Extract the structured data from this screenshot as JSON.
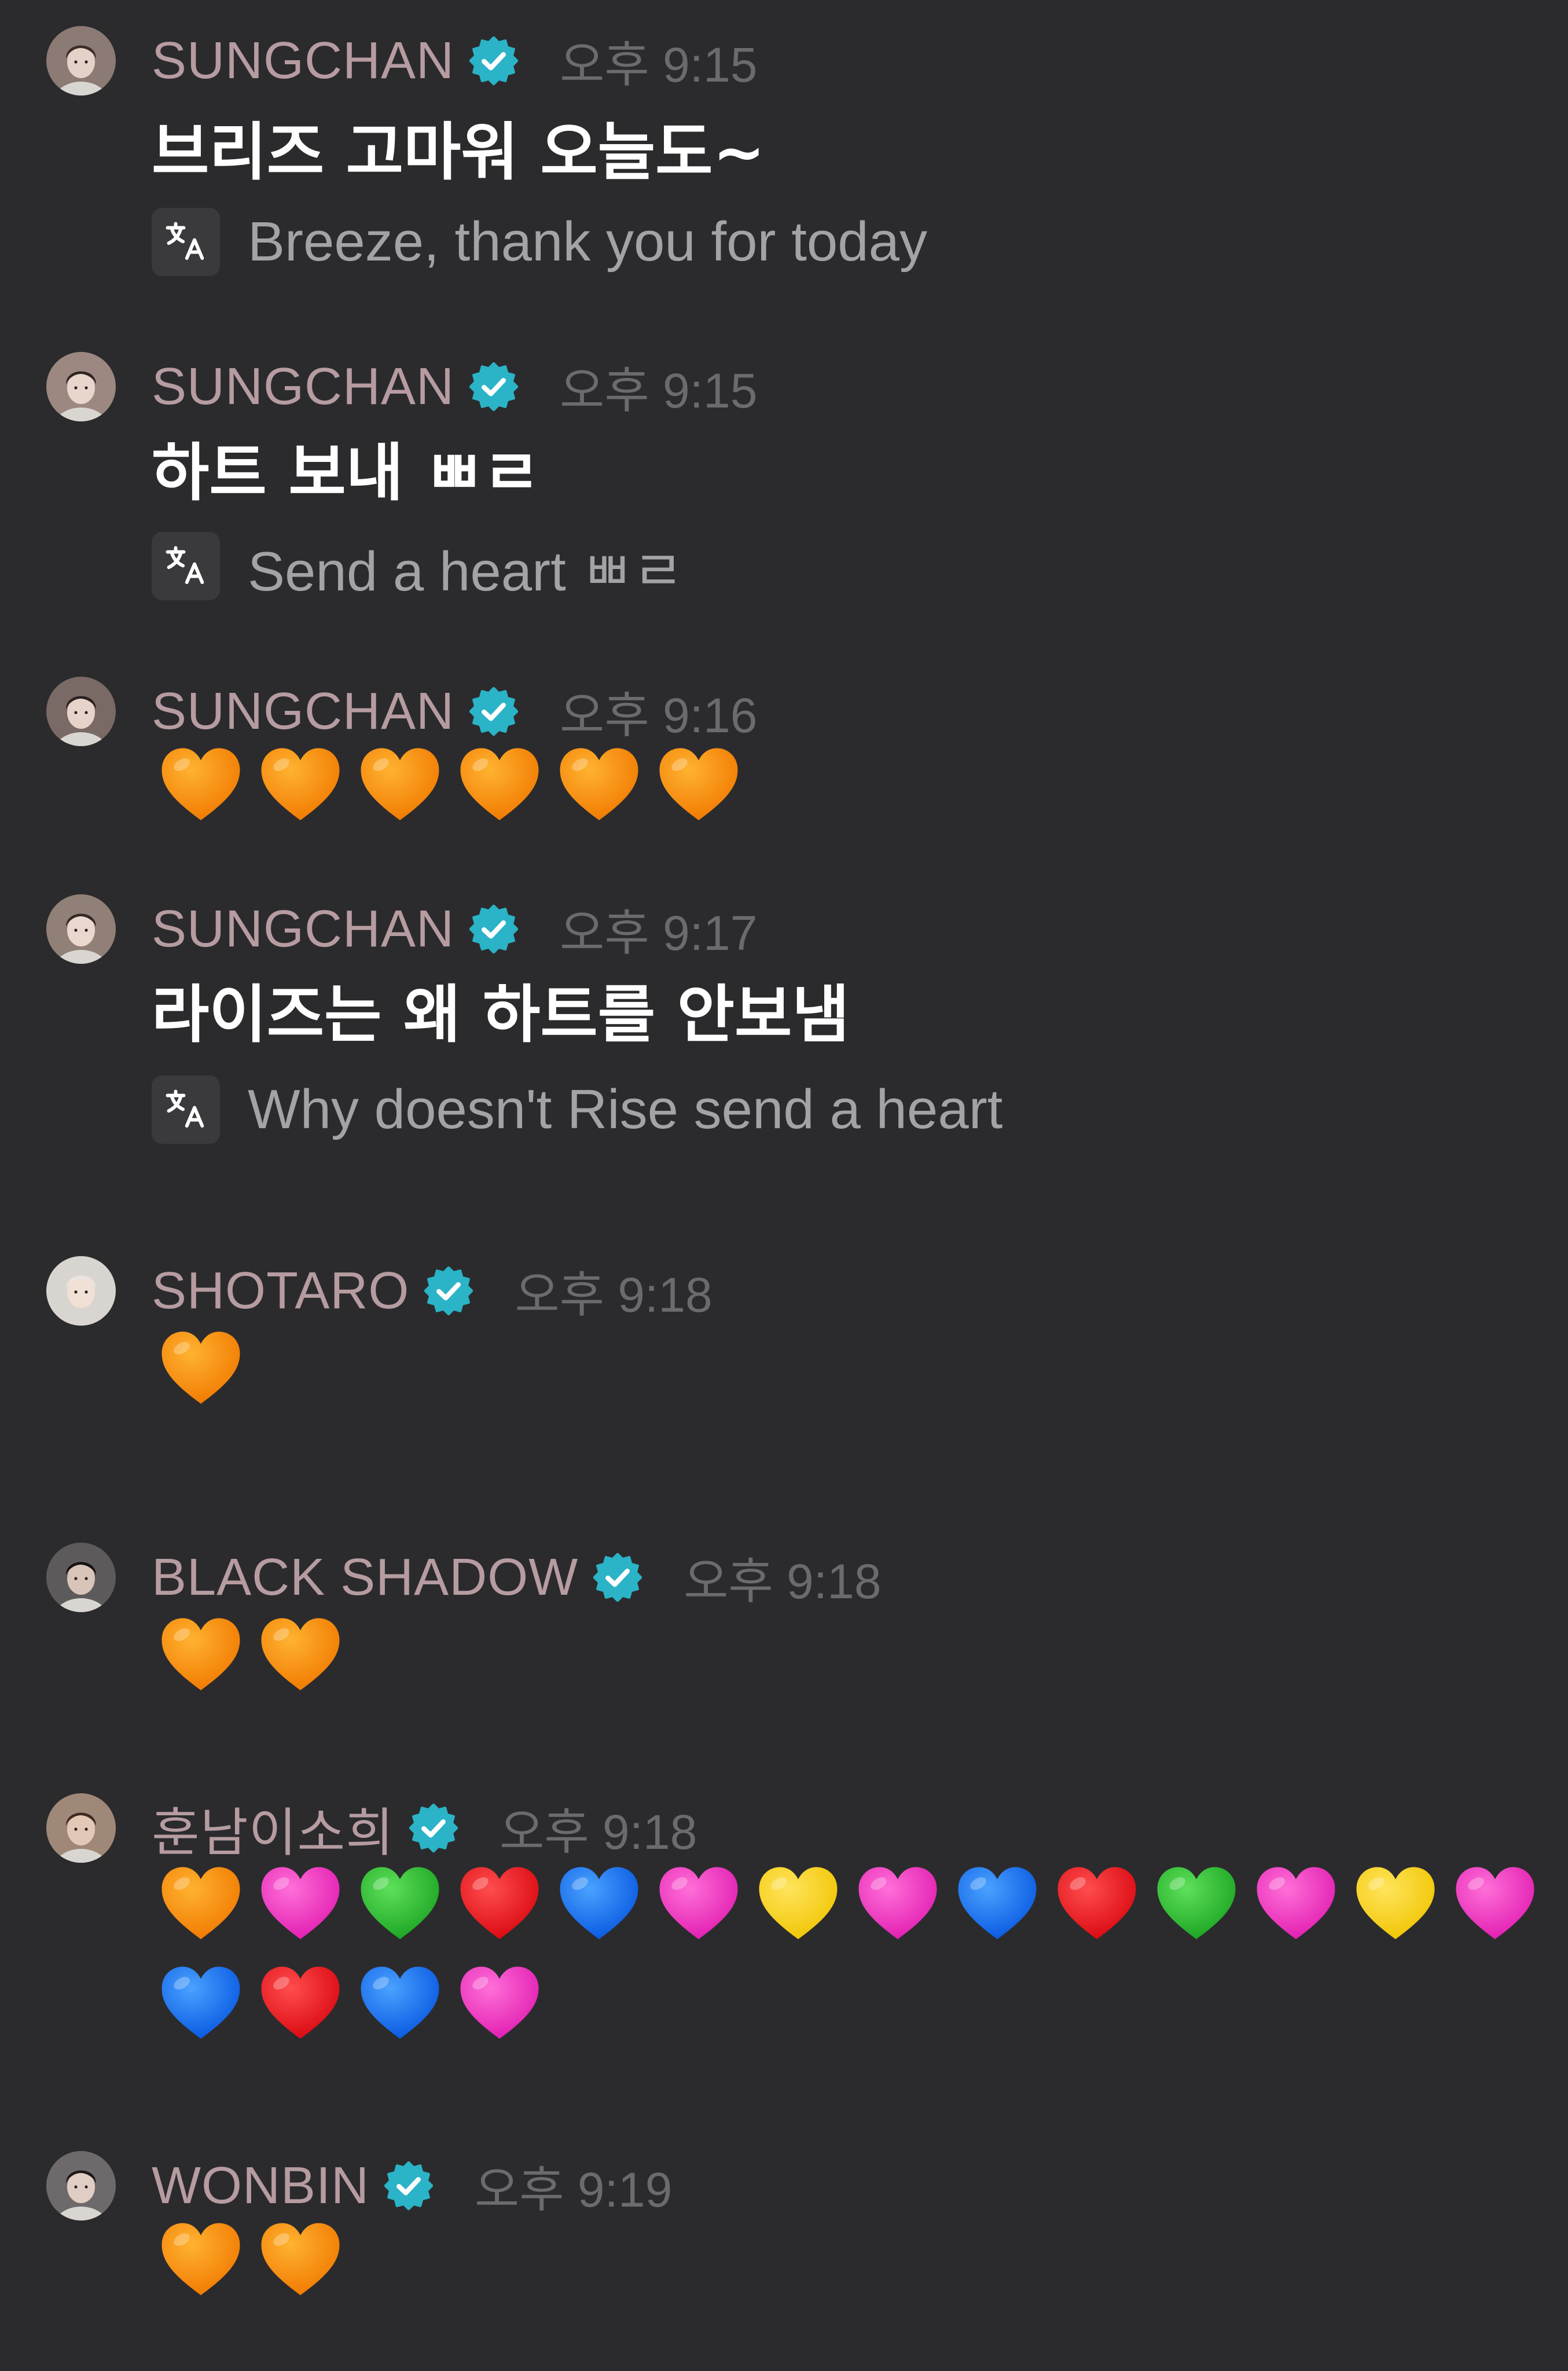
{
  "colors": {
    "background": "#2b2b2d",
    "username": "#b69ca1",
    "timestamp": "#6b6b6f",
    "verified_badge": "#2bb3c7",
    "translation_text": "#a3a3a6"
  },
  "icons": {
    "verified": "verified-check-badge",
    "translate": "translate-icon",
    "heart": "heart-emoji"
  },
  "messages": [
    {
      "user": "SUNGCHAN",
      "verified": true,
      "time": "오후 9:15",
      "text": "브리즈 고마워 오늘도~",
      "translation": "Breeze, thank you for today"
    },
    {
      "user": "SUNGCHAN",
      "verified": true,
      "time": "오후 9:15",
      "text": "하트 보내 ㅃㄹ",
      "translation": "Send a heart ㅃㄹ"
    },
    {
      "user": "SUNGCHAN",
      "verified": true,
      "time": "오후 9:16",
      "hearts": [
        "orange",
        "orange",
        "orange",
        "orange",
        "orange",
        "orange"
      ]
    },
    {
      "user": "SUNGCHAN",
      "verified": true,
      "time": "오후 9:17",
      "text": "라이즈는 왜 하트를 안보냄",
      "translation": "Why doesn't Rise send a heart"
    },
    {
      "user": "SHOTARO",
      "verified": true,
      "time": "오후 9:18",
      "hearts": [
        "orange"
      ]
    },
    {
      "user": "BLACK SHADOW",
      "verified": true,
      "time": "오후 9:18",
      "hearts": [
        "orange",
        "orange"
      ]
    },
    {
      "user": "훈남이소희",
      "verified": true,
      "time": "오후 9:18",
      "hearts": [
        "orange",
        "pink",
        "green",
        "red",
        "blue",
        "pink",
        "yellow",
        "pink",
        "blue",
        "red",
        "green",
        "pink",
        "yellow",
        "pink",
        "blue",
        "red",
        "blue",
        "pink"
      ]
    },
    {
      "user": "WONBIN",
      "verified": true,
      "time": "오후 9:19",
      "hearts": [
        "orange",
        "orange"
      ]
    }
  ]
}
